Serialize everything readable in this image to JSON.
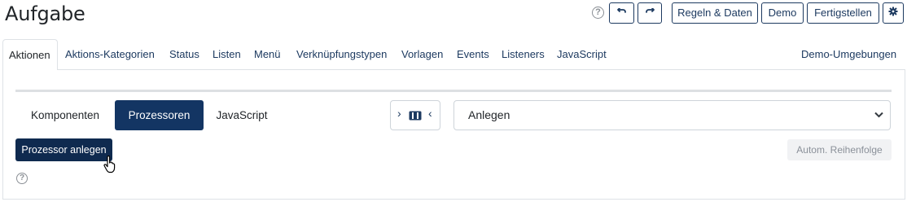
{
  "page": {
    "title": "Aufgabe"
  },
  "header": {
    "help_glyph": "?",
    "undo_icon": "undo-icon",
    "redo_icon": "redo-icon",
    "rules_label": "Regeln & Daten",
    "demo_label": "Demo",
    "finish_label": "Fertigstellen",
    "settings_icon": "gear-icon"
  },
  "tabs": [
    {
      "label": "Aktionen",
      "active": true
    },
    {
      "label": "Aktions-Kategorien"
    },
    {
      "label": "Status"
    },
    {
      "label": "Listen"
    },
    {
      "label": "Menü"
    },
    {
      "label": "Verknüpfungstypen"
    },
    {
      "label": "Vorlagen"
    },
    {
      "label": "Events"
    },
    {
      "label": "Listeners"
    },
    {
      "label": "JavaScript"
    },
    {
      "label": "Demo-Umgebungen"
    }
  ],
  "subnav": {
    "items": [
      {
        "label": "Komponenten"
      },
      {
        "label": "Prozessoren",
        "active": true
      },
      {
        "label": "JavaScript"
      }
    ],
    "toggle_left": "›",
    "toggle_right": "‹",
    "select_value": "Anlegen"
  },
  "actions": {
    "create_label": "Prozessor anlegen",
    "auto_order_label": "Autom. Reihenfolge",
    "help_glyph": "?"
  },
  "colors": {
    "primary": "#133563",
    "border": "#dee2e6"
  }
}
